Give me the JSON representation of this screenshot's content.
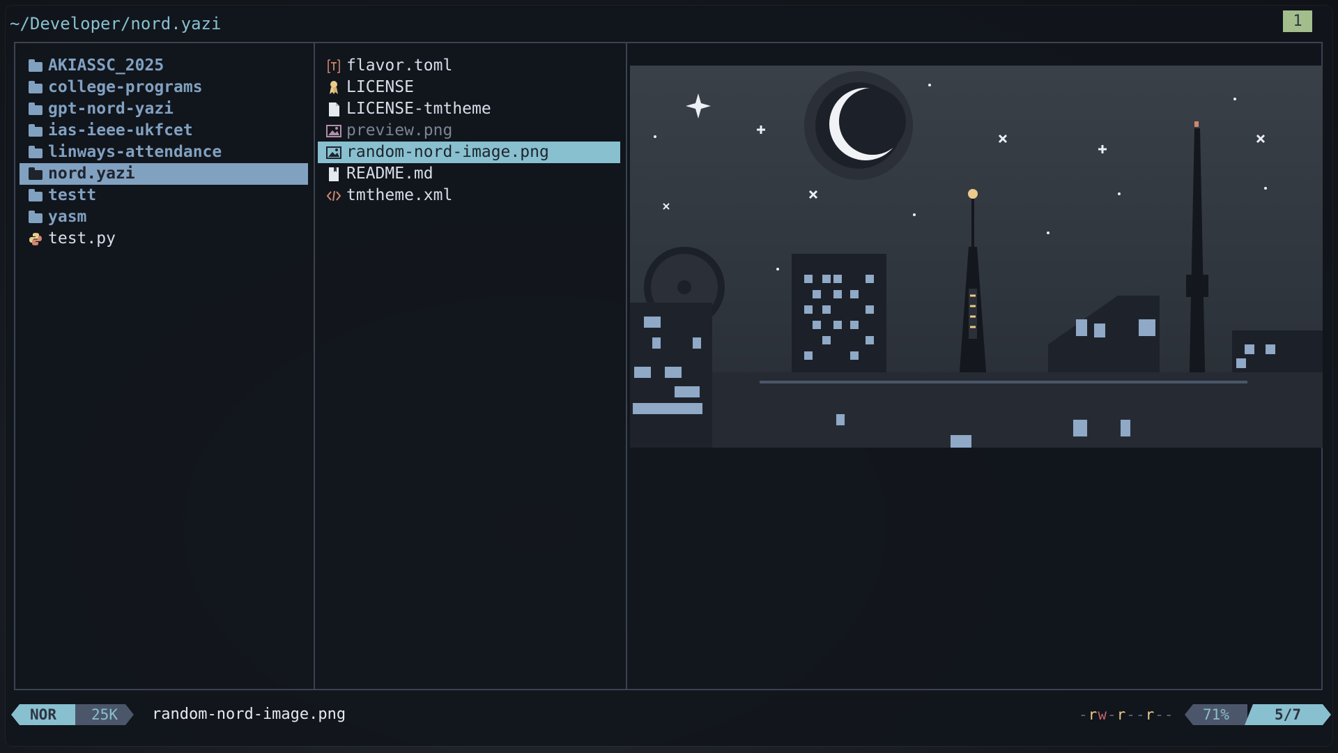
{
  "titlebar": {
    "path": "~/Developer/nord.yazi",
    "tab": "1"
  },
  "parent_pane": {
    "items": [
      {
        "label": "AKIASSC_2025",
        "icon": "folder-icon"
      },
      {
        "label": "college-programs",
        "icon": "folder-icon"
      },
      {
        "label": "gpt-nord-yazi",
        "icon": "folder-icon"
      },
      {
        "label": "ias-ieee-ukfcet",
        "icon": "folder-icon"
      },
      {
        "label": "linways-attendance",
        "icon": "folder-icon"
      },
      {
        "label": "nord.yazi",
        "icon": "folder-icon",
        "selected": true
      },
      {
        "label": "testt",
        "icon": "folder-icon"
      },
      {
        "label": "yasm",
        "icon": "folder-icon"
      },
      {
        "label": "test.py",
        "icon": "python-icon"
      }
    ]
  },
  "current_pane": {
    "items": [
      {
        "label": "flavor.toml",
        "icon": "toml-icon"
      },
      {
        "label": "LICENSE",
        "icon": "license-icon"
      },
      {
        "label": "LICENSE-tmtheme",
        "icon": "file-icon"
      },
      {
        "label": "preview.png",
        "icon": "image-icon"
      },
      {
        "label": "random-nord-image.png",
        "icon": "image-icon",
        "selected": true
      },
      {
        "label": "README.md",
        "icon": "markdown-icon"
      },
      {
        "label": "tmtheme.xml",
        "icon": "code-icon"
      }
    ]
  },
  "statusbar": {
    "mode": "NOR",
    "size": "25K",
    "filename": "random-nord-image.png",
    "permissions": "-rw-r--r--",
    "percent": "71%",
    "position": "5/7"
  },
  "colors": {
    "accent": "#88c0d0",
    "folder": "#81a1c1",
    "tab_badge": "#a3be8c",
    "border": "#3b4252"
  }
}
